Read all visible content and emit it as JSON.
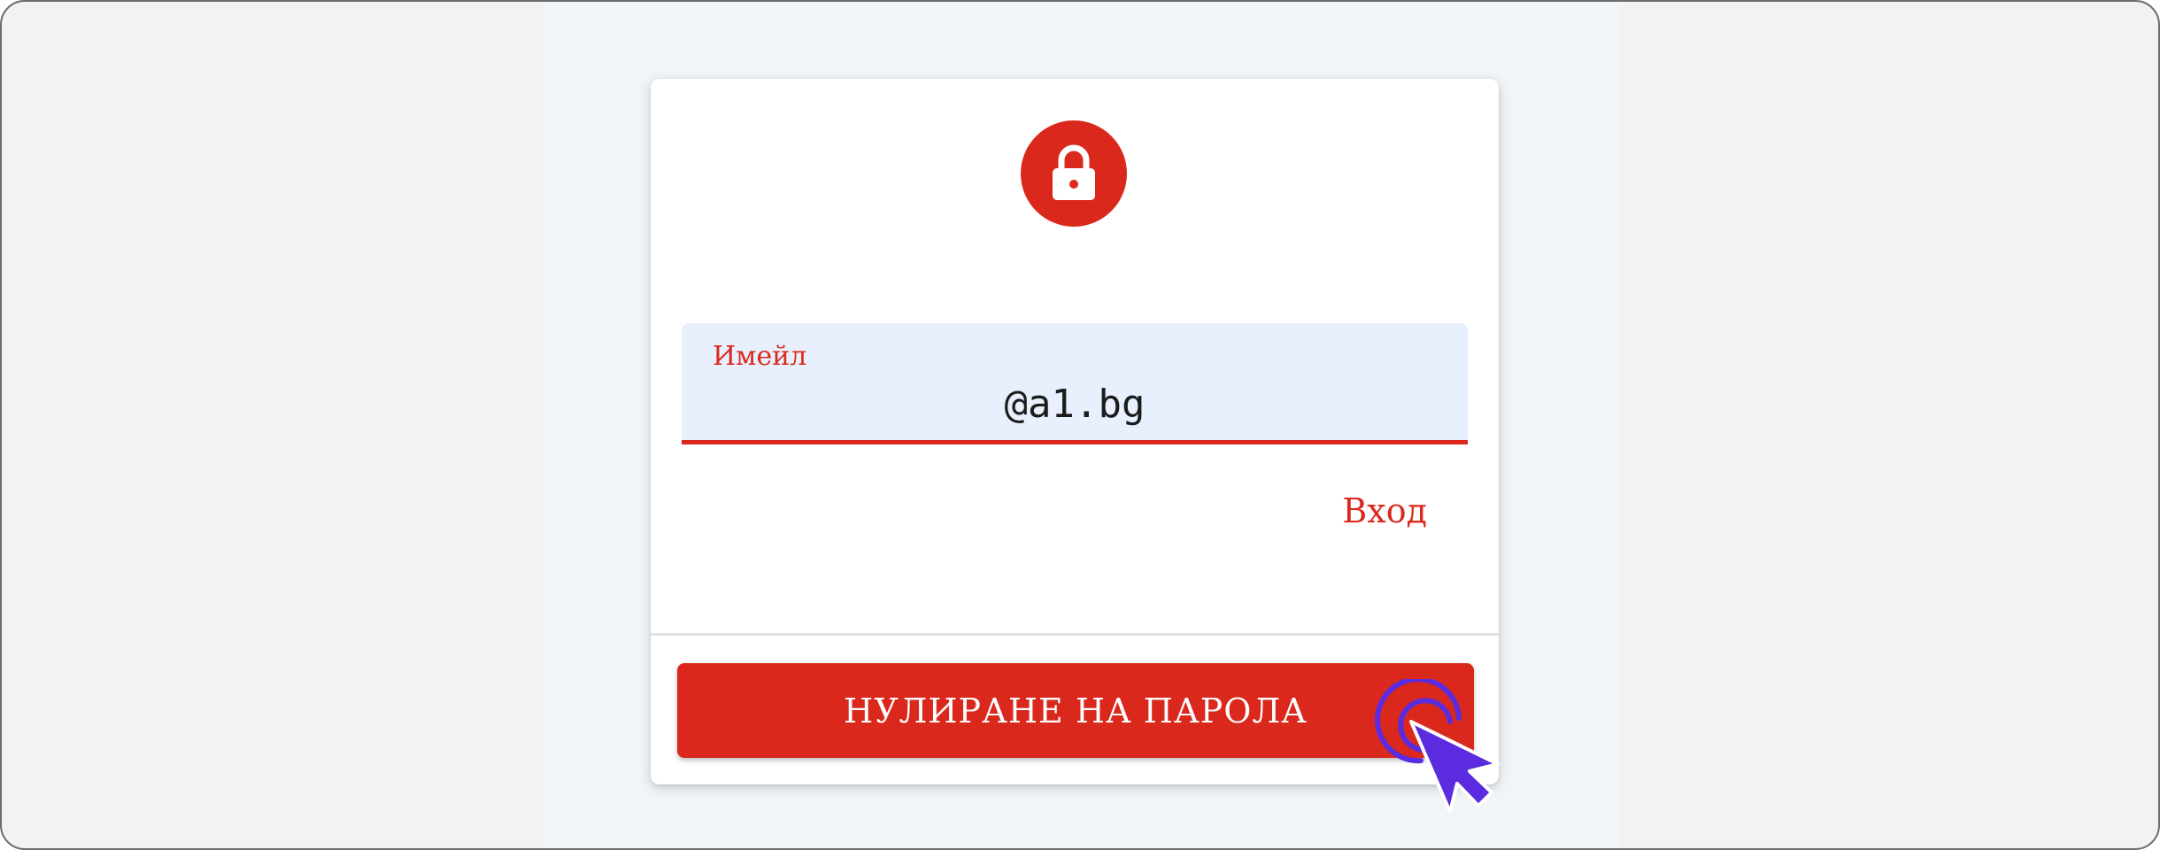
{
  "form": {
    "email_label": "Имейл",
    "email_value": "@a1.bg",
    "login_link": "Вход",
    "reset_button": "НУЛИРАНЕ НА ПАРОЛА"
  },
  "icons": {
    "badge": "lock-icon",
    "pointer": "click-cursor-icon"
  },
  "colors": {
    "accent": "#da291c",
    "field_bg": "#e8f0fe",
    "cursor": "#5b2be0"
  }
}
